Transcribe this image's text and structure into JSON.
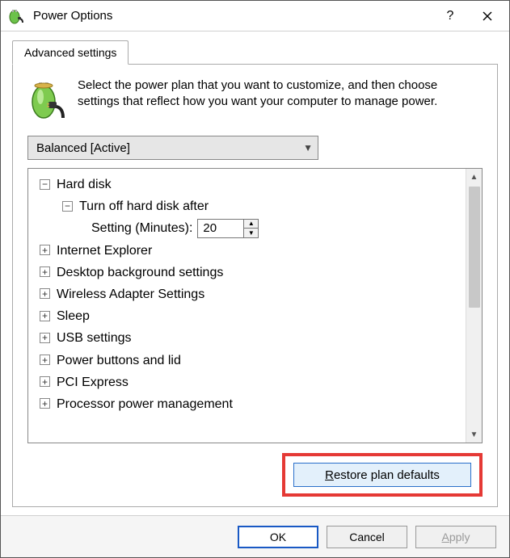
{
  "window": {
    "title": "Power Options"
  },
  "tab": {
    "label": "Advanced settings"
  },
  "intro": "Select the power plan that you want to customize, and then choose settings that reflect how you want your computer to manage power.",
  "plan": {
    "selected": "Balanced [Active]"
  },
  "tree": {
    "hard_disk": {
      "label": "Hard disk",
      "turn_off": {
        "label": "Turn off hard disk after",
        "setting_label": "Setting (Minutes):",
        "value": "20"
      }
    },
    "ie": {
      "label": "Internet Explorer"
    },
    "desk": {
      "label": "Desktop background settings"
    },
    "wifi": {
      "label": "Wireless Adapter Settings"
    },
    "sleep": {
      "label": "Sleep"
    },
    "usb": {
      "label": "USB settings"
    },
    "pwr": {
      "label": "Power buttons and lid"
    },
    "pci": {
      "label": "PCI Express"
    },
    "proc": {
      "label": "Processor power management"
    }
  },
  "buttons": {
    "restore_prefix": "R",
    "restore_rest": "estore plan defaults",
    "ok": "OK",
    "cancel": "Cancel",
    "apply_prefix": "A",
    "apply_rest": "pply"
  }
}
